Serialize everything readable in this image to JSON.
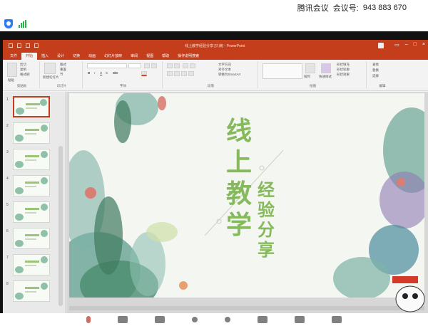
{
  "meeting": {
    "app_name": "腾讯会议",
    "id_label": "会议号:",
    "id_value": "943 883 670"
  },
  "ppt": {
    "window_title": "线上教学经验分享 [只读] - PowerPoint",
    "tabs": [
      "文件",
      "开始",
      "插入",
      "设计",
      "切换",
      "动画",
      "幻灯片放映",
      "审阅",
      "视图",
      "帮助",
      "操作说明搜索"
    ],
    "active_tab": "开始",
    "groups": [
      "剪贴板",
      "幻灯片",
      "字体",
      "段落",
      "绘图",
      "编辑"
    ],
    "ribbon_labels": {
      "paste": "粘贴",
      "cut": "剪切",
      "copy": "复制",
      "format_painter": "格式刷",
      "new_slide": "新建幻灯片",
      "layout": "版式",
      "reset": "重置",
      "section": "节",
      "find": "查找",
      "replace": "替换",
      "select": "选择",
      "shape_fill": "形状填充",
      "shape_outline": "形状轮廓",
      "shape_effect": "形状效果",
      "arrange": "排列",
      "quick_styles": "快速样式",
      "text_direction": "文字方向",
      "align_text": "对齐文本",
      "smartart": "转换为SmartArt"
    },
    "slide_numbers": [
      "1",
      "2",
      "3",
      "4",
      "5",
      "6",
      "7",
      "8"
    ],
    "selected_slide": 1,
    "slide_title_chars": [
      "线",
      "上",
      "教",
      "学",
      "经",
      "验",
      "分",
      "享"
    ]
  },
  "colors": {
    "ppt_accent": "#c43e1c",
    "title_green": "#86b95c",
    "signal_green": "#2ab34a",
    "shield_blue": "#2d7cf6"
  }
}
